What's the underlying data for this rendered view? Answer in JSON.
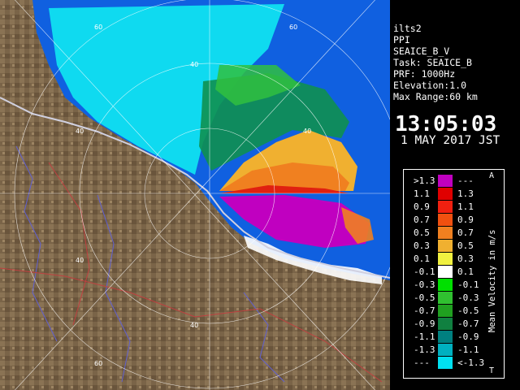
{
  "info": {
    "lines": [
      "ilts2",
      "PPI",
      "SEAICE_B_V",
      "Task: SEAICE_B",
      "PRF: 1000Hz",
      "Elevation:1.0",
      "Max Range:60 km"
    ],
    "time": "13:05:03",
    "date": "1 MAY 2017 JST"
  },
  "legend": {
    "title": "Mean Velocity in m/s",
    "corner_top": "A",
    "corner_bottom": "T",
    "rows": [
      {
        "lo": ">1.3",
        "hi": "---",
        "color": "#c000c0"
      },
      {
        "lo": "1.1",
        "hi": "1.3",
        "color": "#e00000"
      },
      {
        "lo": "0.9",
        "hi": "1.1",
        "color": "#f02010"
      },
      {
        "lo": "0.7",
        "hi": "0.9",
        "color": "#f05010"
      },
      {
        "lo": "0.5",
        "hi": "0.7",
        "color": "#f08020"
      },
      {
        "lo": "0.3",
        "hi": "0.5",
        "color": "#f0b030"
      },
      {
        "lo": "0.1",
        "hi": "0.3",
        "color": "#f0f040"
      },
      {
        "lo": "-0.1",
        "hi": "0.1",
        "color": "#ffffff"
      },
      {
        "lo": "-0.3",
        "hi": "-0.1",
        "color": "#00e000"
      },
      {
        "lo": "-0.5",
        "hi": "-0.3",
        "color": "#30c030"
      },
      {
        "lo": "-0.7",
        "hi": "-0.5",
        "color": "#20a020"
      },
      {
        "lo": "-0.9",
        "hi": "-0.7",
        "color": "#108040"
      },
      {
        "lo": "-1.1",
        "hi": "-0.9",
        "color": "#008080"
      },
      {
        "lo": "-1.3",
        "hi": "-1.1",
        "color": "#00b0c0"
      },
      {
        "lo": "---",
        "hi": "<-1.3",
        "color": "#00e0f0"
      }
    ]
  },
  "map": {
    "range_labels": [
      "60",
      "60",
      "40",
      "40",
      "40",
      "40",
      "40",
      "60"
    ]
  },
  "colors": {
    "land": "#7a6448",
    "sea": "#1060e0",
    "range_ring": "#ffffff"
  }
}
